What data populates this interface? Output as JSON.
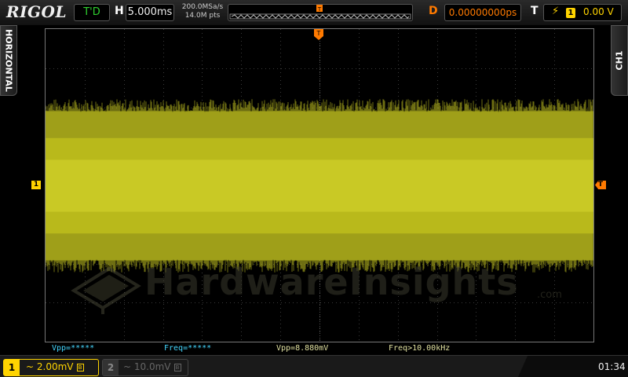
{
  "brand": "RIGOL",
  "mode_label": "T'D",
  "horizontal": {
    "label": "H",
    "timebase": "5.000ms"
  },
  "sampling": {
    "rate": "200.0MSa/s",
    "depth": "14.0M pts"
  },
  "delay": {
    "label": "D",
    "value": "0.00000000ps"
  },
  "trigger": {
    "label": "T",
    "source_icon": "rising-edge-icon",
    "channel": "1",
    "level": "0.00 V"
  },
  "side_tabs": {
    "left": "HORIZONTAL",
    "right": "CH1"
  },
  "markers": {
    "channel1": "1",
    "trigger_level": "T",
    "trigger_position": "T"
  },
  "watermark": {
    "text": "HardwareInsights",
    "suffix": ".com"
  },
  "measurements": [
    {
      "label": "Vpp=*****"
    },
    {
      "label": "Freq=*****"
    },
    {
      "label": "Vpp=8.880mV"
    },
    {
      "label": "Freq>10.00kHz"
    }
  ],
  "channels": [
    {
      "number": "1",
      "coupling": "~",
      "scale": "2.00mV",
      "bw_icon": "B"
    },
    {
      "number": "2",
      "coupling": "~",
      "scale": "10.0mV",
      "bw_icon": "B"
    }
  ],
  "clock": "01:34",
  "colors": {
    "ch1": "#ffd400",
    "trigger": "#ff7a00",
    "measure": "#44d7ff",
    "td": "#2fd12f"
  }
}
